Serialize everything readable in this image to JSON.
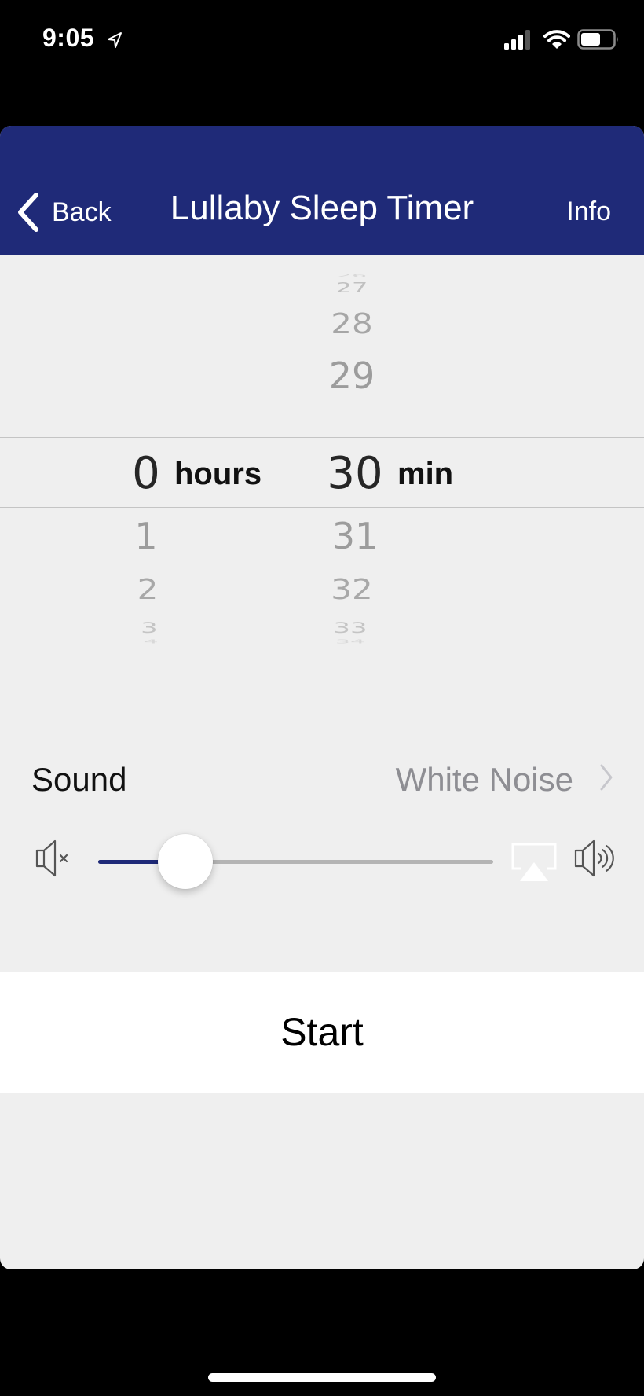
{
  "status_bar": {
    "time": "9:05",
    "icons": [
      "location-arrow-icon",
      "cellular-signal-icon",
      "wifi-icon",
      "battery-icon"
    ]
  },
  "nav": {
    "back_label": "Back",
    "title": "Lullaby Sleep Timer",
    "info_label": "Info",
    "background_color": "#1f2a78"
  },
  "picker": {
    "hours": {
      "selected": "0",
      "unit": "hours",
      "above": [],
      "below": [
        "1",
        "2",
        "3",
        "4"
      ]
    },
    "minutes": {
      "selected": "30",
      "unit": "min",
      "above": [
        "26",
        "27",
        "28",
        "29"
      ],
      "below": [
        "31",
        "32",
        "33",
        "34"
      ]
    }
  },
  "sound": {
    "label": "Sound",
    "value": "White Noise"
  },
  "volume": {
    "level": 0.22,
    "fill_color": "#1f2a78"
  },
  "start_button": {
    "label": "Start"
  }
}
